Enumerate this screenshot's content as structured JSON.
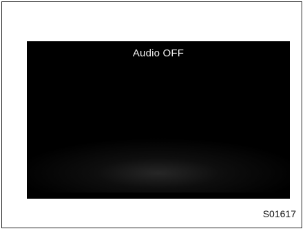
{
  "screen": {
    "status_text": "Audio OFF"
  },
  "figure": {
    "code": "S01617"
  }
}
